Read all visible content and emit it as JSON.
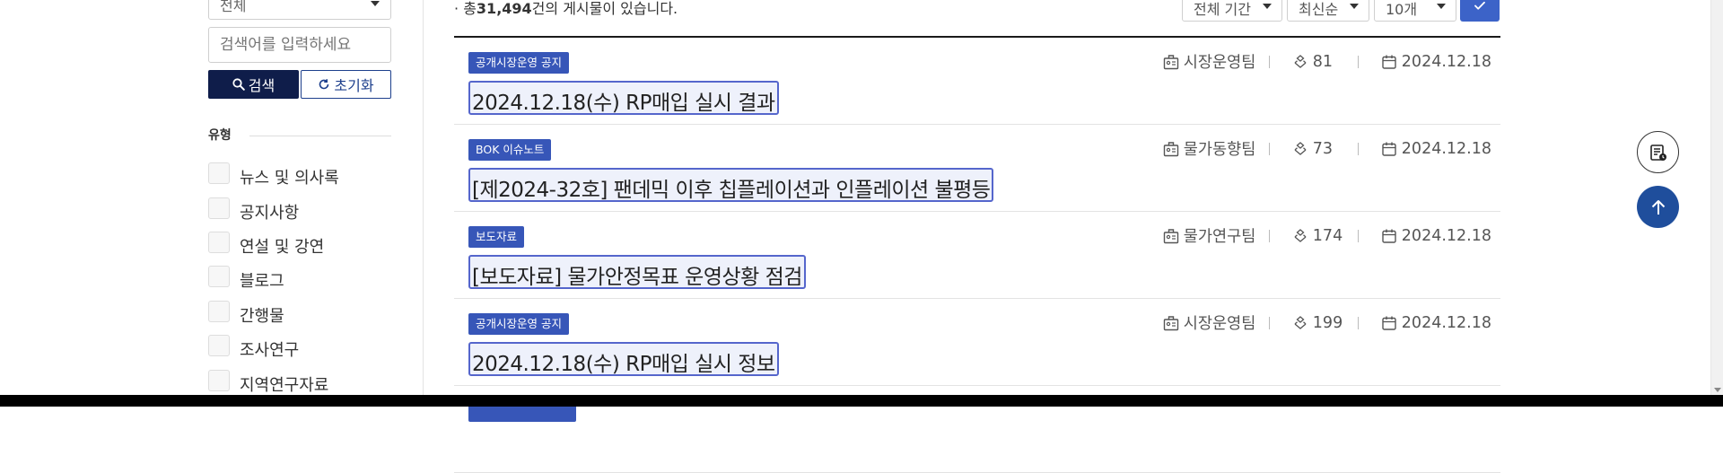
{
  "sidebar": {
    "scope_select": "전체",
    "search": {
      "placeholder": "검색어를 입력하세요",
      "value": ""
    },
    "search_button": "검색",
    "reset_button": "초기화",
    "type_heading": "유형",
    "types": [
      {
        "label": "뉴스 및 의사록",
        "checked": false
      },
      {
        "label": "공지사항",
        "checked": false
      },
      {
        "label": "연설 및 강연",
        "checked": false
      },
      {
        "label": "블로그",
        "checked": false
      },
      {
        "label": "간행물",
        "checked": false
      },
      {
        "label": "조사연구",
        "checked": false
      },
      {
        "label": "지역연구자료",
        "checked": false
      }
    ]
  },
  "results": {
    "bullet": "·",
    "total_prefix": "총",
    "total_count": "31,494",
    "total_suffix": "건의 게시물이 있습니다."
  },
  "filters": {
    "period": "전체 기간",
    "sort": "최신순",
    "page_size": "10개",
    "apply_icon": "check-icon"
  },
  "posts": [
    {
      "category": "공개시장운영 공지",
      "title": "2024.12.18(수) RP매입 실시 결과",
      "team": "시장운영팀",
      "views": "81",
      "date": "2024.12.18"
    },
    {
      "category": "BOK 이슈노트",
      "title": "[제2024-32호] 팬데믹 이후 칩플레이션과 인플레이션 불평등",
      "team": "물가동향팀",
      "views": "73",
      "date": "2024.12.18"
    },
    {
      "category": "보도자료",
      "title": "[보도자료] 물가안정목표 운영상황 점검",
      "team": "물가연구팀",
      "views": "174",
      "date": "2024.12.18"
    },
    {
      "category": "공개시장운영 공지",
      "title": "2024.12.18(수) RP매입 실시 정보",
      "team": "시장운영팀",
      "views": "199",
      "date": "2024.12.18"
    }
  ],
  "floating": {
    "history_icon": "recent-docs-icon",
    "top_icon": "arrow-up-icon"
  },
  "colors": {
    "primary_dark": "#0f1d4a",
    "accent": "#3c63c8",
    "badge": "#3756b8",
    "top_button": "#1f4e9c"
  }
}
